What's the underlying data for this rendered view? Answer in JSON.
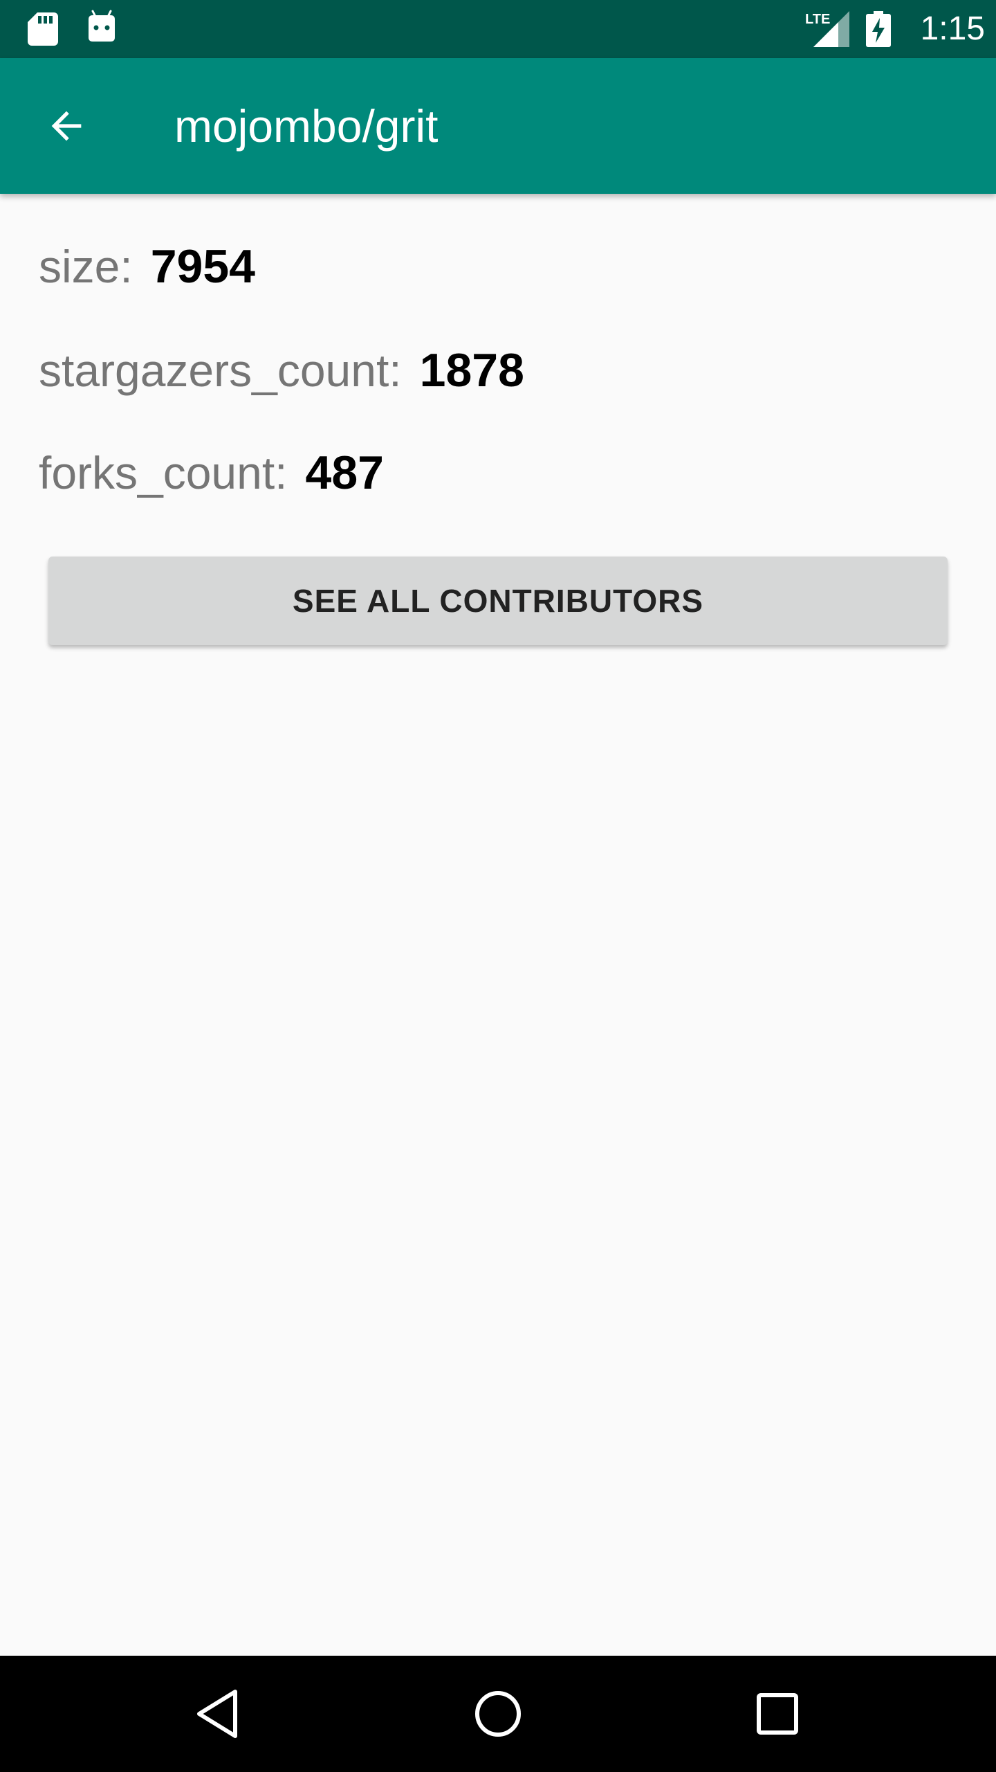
{
  "status_bar": {
    "time": "1:15",
    "icons": [
      "sd-card-icon",
      "android-icon",
      "lte-signal-icon",
      "battery-charging-icon"
    ]
  },
  "app_bar": {
    "title": "mojombo/grit",
    "back_icon": "arrow-back-icon"
  },
  "details": {
    "size_label": "size:",
    "size_value": "7954",
    "stars_label": "stargazers_count:",
    "stars_value": "1878",
    "forks_label": "forks_count:",
    "forks_value": "487"
  },
  "contributors_button": {
    "label": "SEE ALL CONTRIBUTORS"
  },
  "nav_bar": {
    "icons": [
      "nav-back-icon",
      "nav-home-icon",
      "nav-recents-icon"
    ]
  },
  "colors": {
    "status_bar": "#00574b",
    "app_bar": "#00897b",
    "background": "#fafafa",
    "button": "#d6d7d7",
    "label_text": "#757575"
  }
}
